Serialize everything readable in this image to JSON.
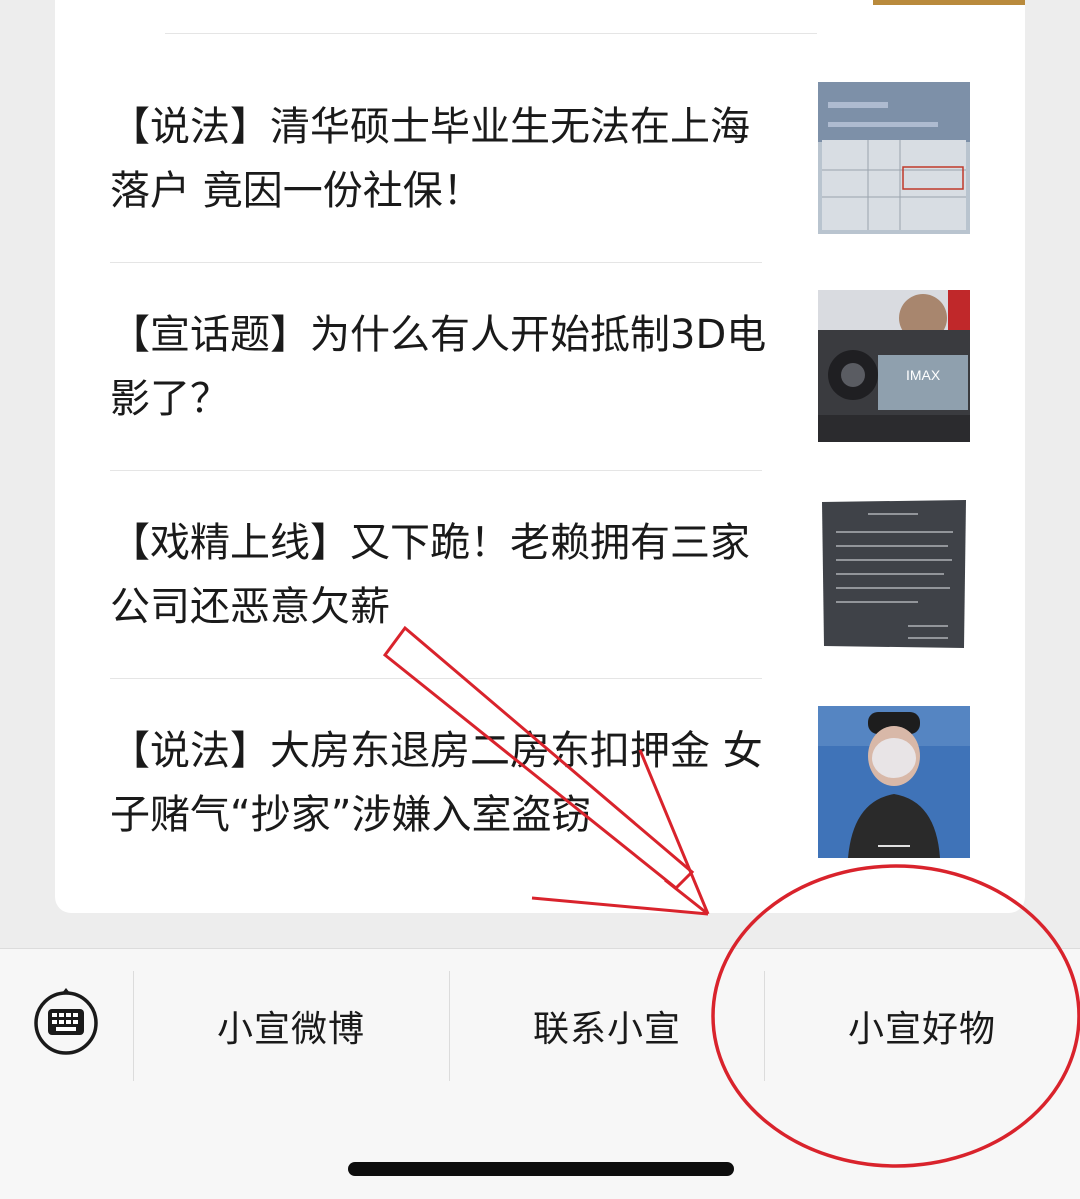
{
  "articles": [
    {
      "title": "【说法】清华硕士毕业生无法在上海落户 竟因一份社保！",
      "thumb": "social-insurance-screenshot"
    },
    {
      "title": "【宣话题】为什么有人开始抵制3D电影了？",
      "thumb": "imax-camera-photo"
    },
    {
      "title": "【戏精上线】又下跪！老赖拥有三家公司还恶意欠薪",
      "thumb": "handwritten-letter-photo"
    },
    {
      "title": "【说法】大房东退房二房东扣押金 女子赌气“抄家”涉嫌入室盗窃",
      "thumb": "blurred-person-photo"
    }
  ],
  "thumb_texts": {
    "imax": "IMAX"
  },
  "menu": {
    "keyboard_icon": "keyboard-icon",
    "items": [
      "小宣微博",
      "联系小宣",
      "小宣好物"
    ]
  },
  "colors": {
    "annotation": "#d9232c",
    "background": "#ededed",
    "card": "#ffffff"
  }
}
